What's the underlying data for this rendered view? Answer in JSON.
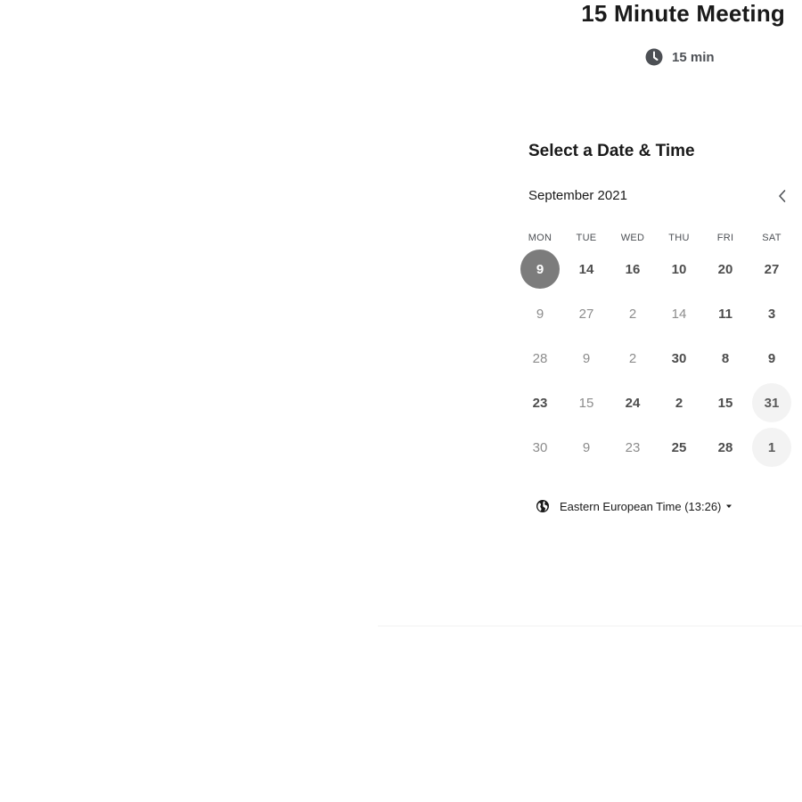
{
  "event": {
    "title": "15 Minute Meeting",
    "duration": "15 min"
  },
  "calendar": {
    "heading": "Select a Date & Time",
    "month": "September 2021",
    "weekdays": [
      "MON",
      "TUE",
      "WED",
      "THU",
      "FRI",
      "SAT"
    ],
    "weeks": [
      [
        {
          "label": "9",
          "state": "selected"
        },
        {
          "label": "14",
          "state": "available"
        },
        {
          "label": "16",
          "state": "available"
        },
        {
          "label": "10",
          "state": "available"
        },
        {
          "label": "20",
          "state": "available"
        },
        {
          "label": "27",
          "state": "available"
        }
      ],
      [
        {
          "label": "9",
          "state": "unavailable"
        },
        {
          "label": "27",
          "state": "unavailable"
        },
        {
          "label": "2",
          "state": "unavailable"
        },
        {
          "label": "14",
          "state": "unavailable"
        },
        {
          "label": "11",
          "state": "available"
        },
        {
          "label": "3",
          "state": "available"
        }
      ],
      [
        {
          "label": "28",
          "state": "unavailable"
        },
        {
          "label": "9",
          "state": "unavailable"
        },
        {
          "label": "2",
          "state": "unavailable"
        },
        {
          "label": "30",
          "state": "available"
        },
        {
          "label": "8",
          "state": "available"
        },
        {
          "label": "9",
          "state": "available"
        }
      ],
      [
        {
          "label": "23",
          "state": "available"
        },
        {
          "label": "15",
          "state": "unavailable"
        },
        {
          "label": "24",
          "state": "available"
        },
        {
          "label": "2",
          "state": "available"
        },
        {
          "label": "15",
          "state": "available"
        },
        {
          "label": "31",
          "state": "highlighted"
        }
      ],
      [
        {
          "label": "30",
          "state": "unavailable"
        },
        {
          "label": "9",
          "state": "unavailable"
        },
        {
          "label": "23",
          "state": "unavailable"
        },
        {
          "label": "25",
          "state": "available"
        },
        {
          "label": "28",
          "state": "available"
        },
        {
          "label": "1",
          "state": "highlighted"
        }
      ]
    ]
  },
  "timezone": {
    "label": "Eastern European Time (13:26)"
  },
  "icons": {
    "duration": "clock-icon",
    "prev": "chevron-left-icon",
    "timezone": "globe-icon",
    "dropdown": "caret-down-icon"
  },
  "colors": {
    "selected_day_bg": "#7c7c7c",
    "highlighted_day_bg": "#f3f3f3",
    "text_primary": "#1a1a1a",
    "text_muted": "#8c8c8c"
  }
}
